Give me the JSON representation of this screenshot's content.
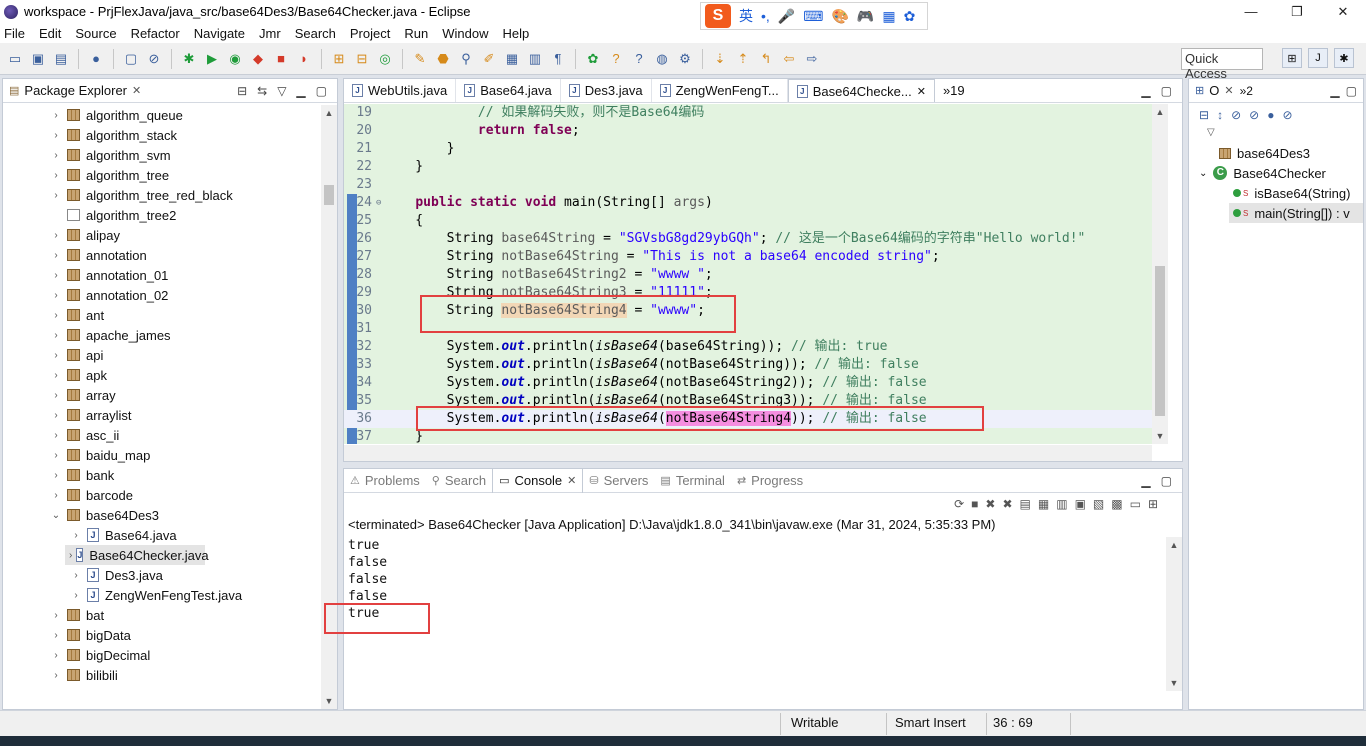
{
  "window": {
    "title": "workspace - PrjFlexJava/java_src/base64Des3/Base64Checker.java - Eclipse",
    "minimize": "—",
    "maximize": "❐",
    "close": "✕"
  },
  "ime": {
    "logo": "S",
    "label": "英",
    "items": [
      "•,",
      "🎤",
      "⌨",
      "🎨",
      "🎮",
      "▦",
      "✿"
    ]
  },
  "menu": [
    "File",
    "Edit",
    "Source",
    "Refactor",
    "Navigate",
    "Jmr",
    "Search",
    "Project",
    "Run",
    "Window",
    "Help"
  ],
  "quick_access": "Quick Access",
  "explorer": {
    "tab": "Package Explorer",
    "items": [
      {
        "label": "algorithm_queue",
        "icon": "package",
        "expand": "›"
      },
      {
        "label": "algorithm_stack",
        "icon": "package",
        "expand": "›"
      },
      {
        "label": "algorithm_svm",
        "icon": "package",
        "expand": "›"
      },
      {
        "label": "algorithm_tree",
        "icon": "package",
        "expand": "›"
      },
      {
        "label": "algorithm_tree_red_black",
        "icon": "package",
        "expand": "›"
      },
      {
        "label": "algorithm_tree2",
        "icon": "package-empty",
        "expand": ""
      },
      {
        "label": "alipay",
        "icon": "package",
        "expand": "›"
      },
      {
        "label": "annotation",
        "icon": "package",
        "expand": "›"
      },
      {
        "label": "annotation_01",
        "icon": "package",
        "expand": "›"
      },
      {
        "label": "annotation_02",
        "icon": "package",
        "expand": "›"
      },
      {
        "label": "ant",
        "icon": "package",
        "expand": "›"
      },
      {
        "label": "apache_james",
        "icon": "package",
        "expand": "›"
      },
      {
        "label": "api",
        "icon": "package",
        "expand": "›"
      },
      {
        "label": "apk",
        "icon": "package",
        "expand": "›"
      },
      {
        "label": "array",
        "icon": "package",
        "expand": "›"
      },
      {
        "label": "arraylist",
        "icon": "package",
        "expand": "›"
      },
      {
        "label": "asc_ii",
        "icon": "package",
        "expand": "›"
      },
      {
        "label": "baidu_map",
        "icon": "package",
        "expand": "›"
      },
      {
        "label": "bank",
        "icon": "package",
        "expand": "›"
      },
      {
        "label": "barcode",
        "icon": "package",
        "expand": "›"
      },
      {
        "label": "base64Des3",
        "icon": "package",
        "expand": "⌄"
      },
      {
        "label": "Base64.java",
        "icon": "java",
        "expand": "›",
        "child": true
      },
      {
        "label": "Base64Checker.java",
        "icon": "java",
        "expand": "›",
        "child": true,
        "selected": true
      },
      {
        "label": "Des3.java",
        "icon": "java",
        "expand": "›",
        "child": true
      },
      {
        "label": "ZengWenFengTest.java",
        "icon": "java",
        "expand": "›",
        "child": true
      },
      {
        "label": "bat",
        "icon": "package",
        "expand": "›"
      },
      {
        "label": "bigData",
        "icon": "package",
        "expand": "›"
      },
      {
        "label": "bigDecimal",
        "icon": "package",
        "expand": "›"
      },
      {
        "label": "bilibili",
        "icon": "package",
        "expand": "›"
      }
    ]
  },
  "editor": {
    "tabs": [
      "WebUtils.java",
      "Base64.java",
      "Des3.java",
      "ZengWenFengT...",
      "Base64Checke..."
    ],
    "overflow": "»19",
    "lines": [
      {
        "n": "19",
        "parts": [
          {
            "t": "            // 如果解码失败，则不是Base64编码",
            "c": "cmt"
          }
        ]
      },
      {
        "n": "20",
        "parts": [
          {
            "t": "            "
          },
          {
            "t": "return",
            "c": "kw"
          },
          {
            "t": " "
          },
          {
            "t": "false",
            "c": "kw"
          },
          {
            "t": ";"
          }
        ]
      },
      {
        "n": "21",
        "parts": [
          {
            "t": "        }"
          }
        ]
      },
      {
        "n": "22",
        "parts": [
          {
            "t": "    }"
          }
        ]
      },
      {
        "n": "23",
        "parts": [
          {
            "t": ""
          }
        ]
      },
      {
        "n": "24",
        "fold": "⊖",
        "parts": [
          {
            "t": "    "
          },
          {
            "t": "public",
            "c": "kw"
          },
          {
            "t": " "
          },
          {
            "t": "static",
            "c": "kw"
          },
          {
            "t": " "
          },
          {
            "t": "void",
            "c": "kw"
          },
          {
            "t": " main(String[] "
          },
          {
            "t": "args",
            "c": "var"
          },
          {
            "t": ")"
          }
        ]
      },
      {
        "n": "25",
        "parts": [
          {
            "t": "    {"
          }
        ]
      },
      {
        "n": "26",
        "parts": [
          {
            "t": "        String "
          },
          {
            "t": "base64String",
            "c": "var"
          },
          {
            "t": " = "
          },
          {
            "t": "\"SGVsbG8gd29ybGQh\"",
            "c": "str"
          },
          {
            "t": "; "
          },
          {
            "t": "// 这是一个Base64编码的字符串\"Hello world!\"",
            "c": "cmt"
          }
        ]
      },
      {
        "n": "27",
        "parts": [
          {
            "t": "        String "
          },
          {
            "t": "notBase64String",
            "c": "var"
          },
          {
            "t": " = "
          },
          {
            "t": "\"This is not a base64 encoded string\"",
            "c": "str"
          },
          {
            "t": ";"
          }
        ]
      },
      {
        "n": "28",
        "parts": [
          {
            "t": "        String "
          },
          {
            "t": "notBase64String2",
            "c": "var"
          },
          {
            "t": " = "
          },
          {
            "t": "\"wwww \"",
            "c": "str"
          },
          {
            "t": ";"
          }
        ]
      },
      {
        "n": "29",
        "parts": [
          {
            "t": "        String "
          },
          {
            "t": "notBase64String3",
            "c": "var"
          },
          {
            "t": " = "
          },
          {
            "t": "\"11111\"",
            "c": "str"
          },
          {
            "t": ";"
          }
        ]
      },
      {
        "n": "30",
        "parts": [
          {
            "t": "        String "
          },
          {
            "t": "notBase64String4",
            "c": "hl-occ var"
          },
          {
            "t": " = "
          },
          {
            "t": "\"wwww\"",
            "c": "str"
          },
          {
            "t": ";"
          }
        ]
      },
      {
        "n": "31",
        "parts": [
          {
            "t": ""
          }
        ]
      },
      {
        "n": "32",
        "parts": [
          {
            "t": "        System."
          },
          {
            "t": "out",
            "c": "fld"
          },
          {
            "t": ".println("
          },
          {
            "t": "isBase64",
            "c": "mth"
          },
          {
            "t": "(base64String)); "
          },
          {
            "t": "// 输出: true",
            "c": "cmt"
          }
        ]
      },
      {
        "n": "33",
        "parts": [
          {
            "t": "        System."
          },
          {
            "t": "out",
            "c": "fld"
          },
          {
            "t": ".println("
          },
          {
            "t": "isBase64",
            "c": "mth"
          },
          {
            "t": "(notBase64String)); "
          },
          {
            "t": "// 输出: false",
            "c": "cmt"
          }
        ]
      },
      {
        "n": "34",
        "parts": [
          {
            "t": "        System."
          },
          {
            "t": "out",
            "c": "fld"
          },
          {
            "t": ".println("
          },
          {
            "t": "isBase64",
            "c": "mth"
          },
          {
            "t": "(notBase64String2)); "
          },
          {
            "t": "// 输出: false",
            "c": "cmt"
          }
        ]
      },
      {
        "n": "35",
        "parts": [
          {
            "t": "        System."
          },
          {
            "t": "out",
            "c": "fld"
          },
          {
            "t": ".println("
          },
          {
            "t": "isBase64",
            "c": "mth"
          },
          {
            "t": "(notBase64String3)); "
          },
          {
            "t": "// 输出: false",
            "c": "cmt"
          }
        ]
      },
      {
        "n": "36",
        "current": true,
        "parts": [
          {
            "t": "        System."
          },
          {
            "t": "out",
            "c": "fld"
          },
          {
            "t": ".println("
          },
          {
            "t": "isBase64",
            "c": "mth"
          },
          {
            "t": "("
          },
          {
            "t": "notBase64String4",
            "c": "hl-sel"
          },
          {
            "t": ")); "
          },
          {
            "t": "// 输出: false",
            "c": "cmt"
          }
        ]
      },
      {
        "n": "37",
        "parts": [
          {
            "t": "    }"
          }
        ]
      }
    ]
  },
  "outline": {
    "tab": "O",
    "overflow": "»2",
    "items": [
      {
        "label": "base64Des3",
        "indent": 1
      },
      {
        "label": "Base64Checker",
        "indent": 0,
        "expand": "⌄"
      },
      {
        "label": "isBase64(String)",
        "indent": 2,
        "mark": "S"
      },
      {
        "label": "main(String[]) : v",
        "indent": 2,
        "mark": "S",
        "selected": true
      }
    ]
  },
  "console": {
    "tabs": [
      "Problems",
      "Search",
      "Console",
      "Servers",
      "Terminal",
      "Progress"
    ],
    "active_tab": "Console",
    "info": "<terminated> Base64Checker [Java Application] D:\\Java\\jdk1.8.0_341\\bin\\javaw.exe (Mar 31, 2024, 5:35:33 PM)",
    "output": [
      "true",
      "false",
      "false",
      "false",
      "true"
    ]
  },
  "status": {
    "writable": "Writable",
    "insert": "Smart Insert",
    "position": "36 : 69"
  }
}
